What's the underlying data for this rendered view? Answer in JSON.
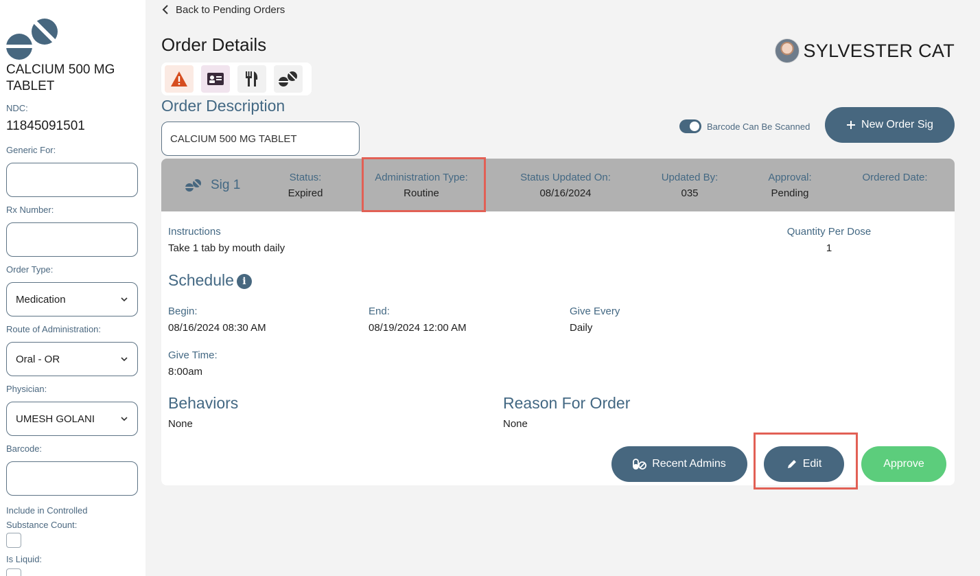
{
  "sidebar": {
    "drug_name": "CALCIUM 500 MG TABLET",
    "ndc_label": "NDC:",
    "ndc_value": "11845091501",
    "generic_for_label": "Generic For:",
    "rx_number_label": "Rx Number:",
    "order_type_label": "Order Type:",
    "order_type_value": "Medication",
    "route_label": "Route of Administration:",
    "route_value": "Oral - OR",
    "physician_label": "Physician:",
    "physician_value": "UMESH GOLANI",
    "barcode_label": "Barcode:",
    "controlled_label": "Include in Controlled Substance Count:",
    "liquid_label": "Is Liquid:"
  },
  "header": {
    "back_link": "Back to Pending Orders",
    "title": "Order Details",
    "patient_name": "SYLVESTER CAT",
    "tray_icons": [
      "warning-icon",
      "id-card-icon",
      "utensils-icon",
      "pills-icon"
    ]
  },
  "order": {
    "section_title": "Order Description",
    "description_value": "CALCIUM 500 MG TABLET",
    "barcode_toggle_label": "Barcode Can Be Scanned",
    "new_sig_label": "New Order Sig"
  },
  "sig": {
    "label": "Sig 1",
    "status_label": "Status:",
    "status_value": "Expired",
    "admin_type_label": "Administration Type:",
    "admin_type_value": "Routine",
    "status_updated_label": "Status Updated On:",
    "status_updated_value": "08/16/2024",
    "updated_by_label": "Updated By:",
    "updated_by_value": "035",
    "approval_label": "Approval:",
    "approval_value": "Pending",
    "ordered_date_label": "Ordered Date:",
    "instructions_label": "Instructions",
    "instructions_value": "Take 1 tab by mouth daily",
    "qty_label": "Quantity Per Dose",
    "qty_value": "1",
    "schedule_heading": "Schedule",
    "begin_label": "Begin:",
    "begin_value": "08/16/2024 08:30 AM",
    "end_label": "End:",
    "end_value": "08/19/2024 12:00 AM",
    "give_every_label": "Give Every",
    "give_every_value": "Daily",
    "give_time_label": "Give Time:",
    "give_time_value": "8:00am",
    "behaviors_heading": "Behaviors",
    "behaviors_value": "None",
    "reason_heading": "Reason For Order",
    "reason_value": "None",
    "recent_admins_label": "Recent Admins",
    "edit_label": "Edit",
    "approve_label": "Approve"
  },
  "colors": {
    "accent": "#47677f",
    "label": "#436883",
    "approve": "#5ccd7c",
    "highlight": "#e26055",
    "header_band": "#b1b1b1"
  }
}
